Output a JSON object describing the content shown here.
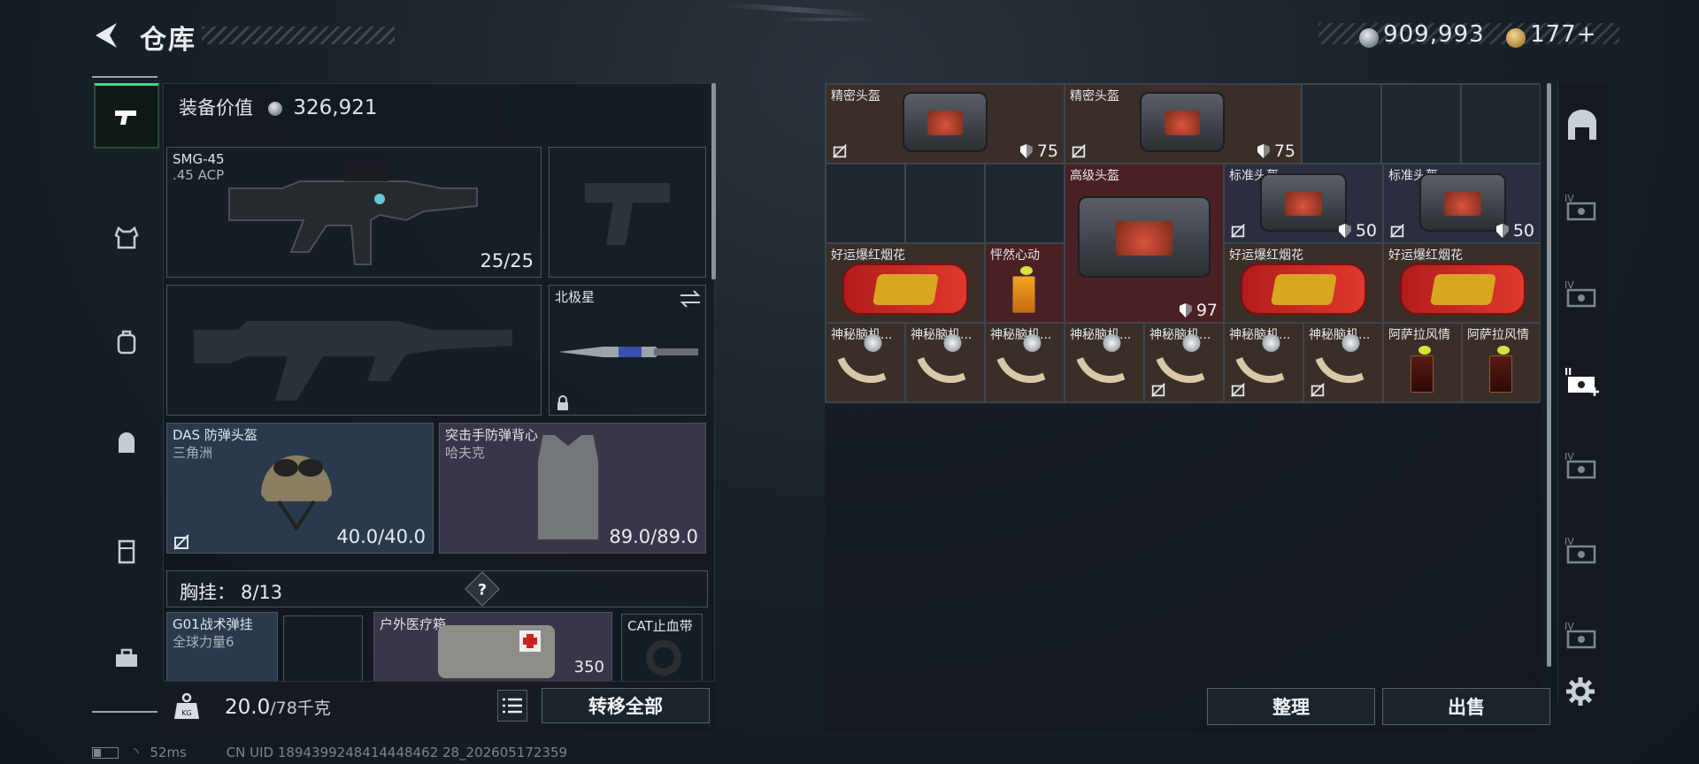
{
  "header": {
    "title": "仓库",
    "silver_amount": "909,993",
    "gold_amount": "177",
    "gold_plus": "+"
  },
  "equipment": {
    "value_label": "装备价值",
    "value": "326,921",
    "primary_weapon": {
      "name": "SMG-45",
      "caliber": ".45 ACP",
      "ammo": "25/25"
    },
    "melee": {
      "name": "北极星"
    },
    "helmet": {
      "name": "DAS 防弹头盔",
      "sub": "三角洲",
      "durability": "40.0/40.0"
    },
    "armor": {
      "name": "突击手防弹背心",
      "sub": "哈夫克",
      "durability": "89.0/89.0"
    },
    "chest_rig": {
      "label": "胸挂：",
      "capacity": "8/13",
      "help": "?"
    },
    "rig_items": [
      {
        "name": "G01战术弹挂",
        "sub": "全球力量6"
      },
      {
        "name": "户外医疗箱",
        "value": "350"
      },
      {
        "name": "CAT止血带"
      }
    ]
  },
  "bottom_bar": {
    "weight": "20.0",
    "weight_max": "/78千克",
    "transfer_all": "转移全部"
  },
  "status": {
    "ping": "52ms",
    "uid": "CN UID 1894399248414448462 28_202605172359"
  },
  "stash": {
    "items": [
      {
        "name": "精密头盔",
        "durability": "75",
        "type": "bag",
        "color": "brown"
      },
      {
        "name": "精密头盔",
        "durability": "75",
        "type": "bag",
        "color": "brown"
      },
      {
        "name": "高级头盔",
        "durability": "97",
        "type": "bag",
        "color": "red"
      },
      {
        "name": "标准头盔",
        "durability": "50",
        "type": "bag",
        "color": "navy"
      },
      {
        "name": "标准头盔",
        "durability": "50",
        "type": "bag",
        "color": "navy"
      },
      {
        "name": "好运爆红烟花",
        "type": "firework",
        "color": "brown"
      },
      {
        "name": "怦然心动",
        "type": "drink",
        "color": "red"
      },
      {
        "name": "好运爆红烟花",
        "type": "firework",
        "color": "brown"
      },
      {
        "name": "好运爆红烟花",
        "type": "firework",
        "color": "brown"
      },
      {
        "name": "神秘脑机...",
        "type": "tusk"
      },
      {
        "name": "神秘脑机...",
        "type": "tusk"
      },
      {
        "name": "神秘脑机...",
        "type": "tusk"
      },
      {
        "name": "神秘脑机...",
        "type": "tusk"
      },
      {
        "name": "神秘脑机...",
        "type": "tusk"
      },
      {
        "name": "神秘脑机...",
        "type": "tusk"
      },
      {
        "name": "神秘脑机...",
        "type": "tusk"
      },
      {
        "name": "阿萨拉风情",
        "type": "drink"
      },
      {
        "name": "阿萨拉风情",
        "type": "drink"
      }
    ],
    "sort_label": "整理",
    "sell_label": "出售"
  },
  "right_rail": {
    "tabs": [
      "IV",
      "IV",
      "II",
      "IV",
      "IV",
      "IV"
    ]
  },
  "colors": {
    "accent_green": "#4fcf8a",
    "brown_cell": "#3a2e28",
    "red_cell": "#4a2024",
    "navy_cell": "#2a2e3e"
  }
}
